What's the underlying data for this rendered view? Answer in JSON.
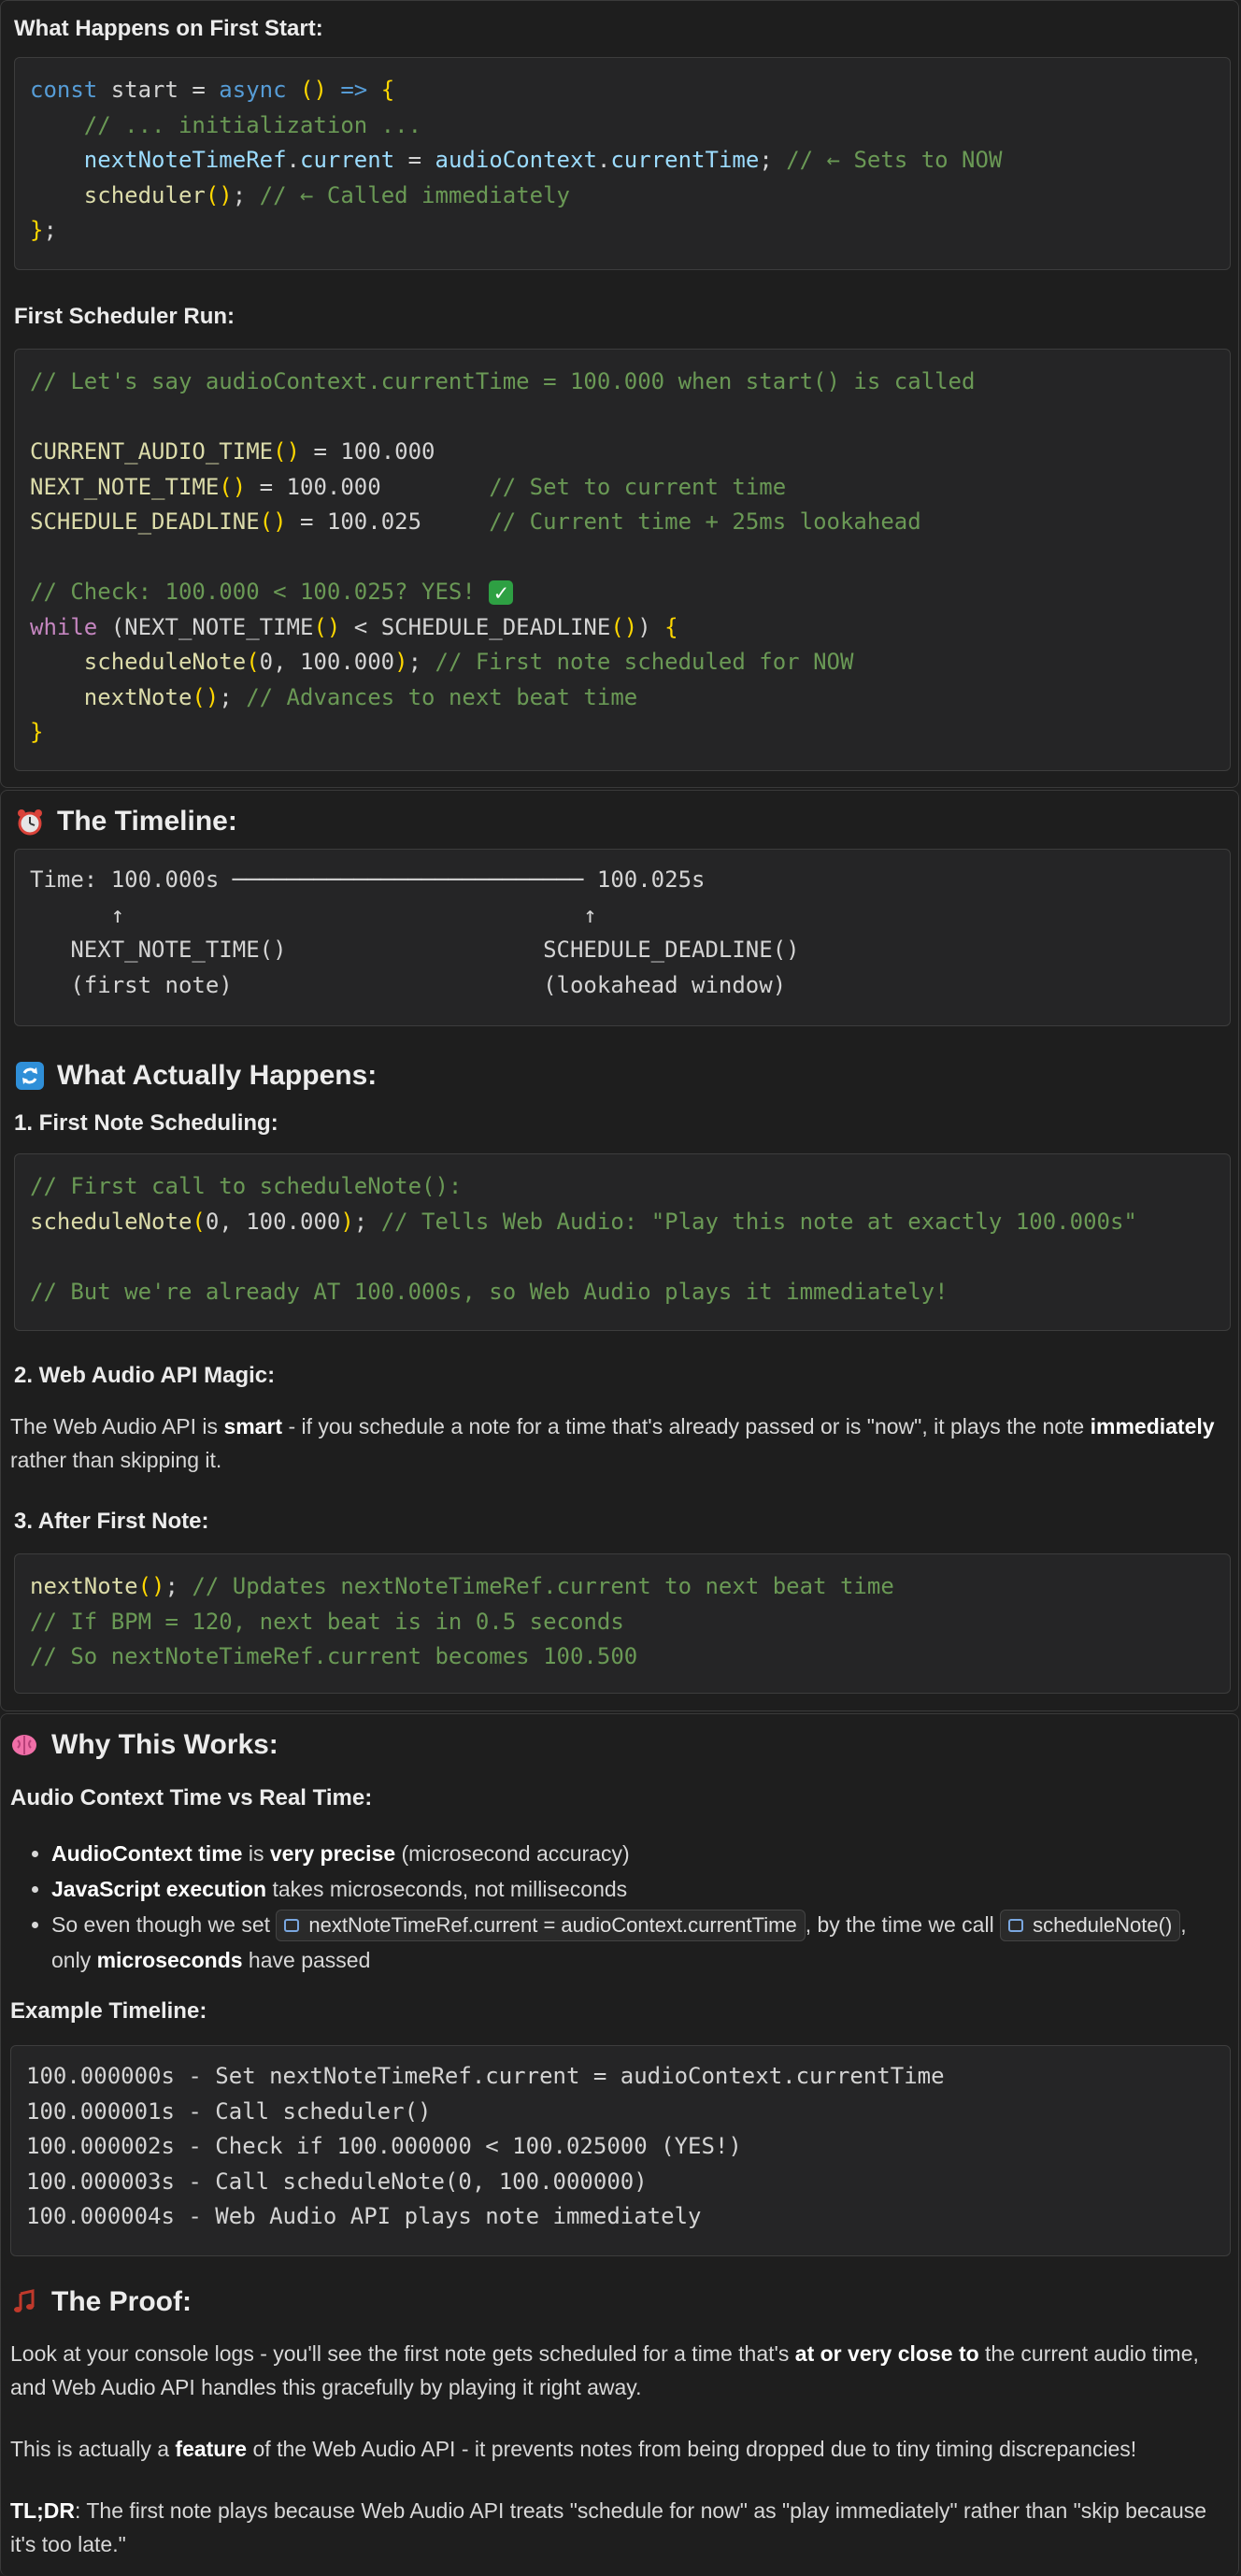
{
  "panel1": {
    "heading1": "What Happens on First Start:",
    "code1": [
      [
        [
          "k",
          "const"
        ],
        [
          "t",
          " start = "
        ],
        [
          "k",
          "async"
        ],
        [
          "t",
          " "
        ],
        [
          "p",
          "()"
        ],
        [
          "t",
          " "
        ],
        [
          "k",
          "=>"
        ],
        [
          "t",
          " "
        ],
        [
          "p",
          "{"
        ]
      ],
      [
        [
          "t",
          "    "
        ],
        [
          "c",
          "// ... initialization ..."
        ]
      ],
      [
        [
          "t",
          "    "
        ],
        [
          "v",
          "nextNoteTimeRef"
        ],
        [
          "t",
          "."
        ],
        [
          "v",
          "current"
        ],
        [
          "t",
          " = "
        ],
        [
          "v",
          "audioContext"
        ],
        [
          "t",
          "."
        ],
        [
          "v",
          "currentTime"
        ],
        [
          "t",
          "; "
        ],
        [
          "c",
          "// ← Sets to NOW"
        ]
      ],
      [
        [
          "t",
          "    "
        ],
        [
          "fn",
          "scheduler"
        ],
        [
          "p",
          "()"
        ],
        [
          "t",
          "; "
        ],
        [
          "c",
          "// ← Called immediately"
        ]
      ],
      [
        [
          "p",
          "}"
        ],
        [
          "t",
          ";"
        ]
      ]
    ],
    "heading2": "First Scheduler Run:",
    "code2": [
      [
        [
          "c",
          "// Let's say audioContext.currentTime = 100.000 when start() is called"
        ]
      ],
      [
        [
          "t",
          ""
        ]
      ],
      [
        [
          "fn",
          "CURRENT_AUDIO_TIME"
        ],
        [
          "p",
          "()"
        ],
        [
          "t",
          " = 100.000"
        ]
      ],
      [
        [
          "fn",
          "NEXT_NOTE_TIME"
        ],
        [
          "p",
          "()"
        ],
        [
          "t",
          " = 100.000        "
        ],
        [
          "c",
          "// Set to current time"
        ]
      ],
      [
        [
          "fn",
          "SCHEDULE_DEADLINE"
        ],
        [
          "p",
          "()"
        ],
        [
          "t",
          " = 100.025     "
        ],
        [
          "c",
          "// Current time + 25ms lookahead"
        ]
      ],
      [
        [
          "t",
          ""
        ]
      ],
      [
        [
          "c",
          "// Check: 100.000 < 100.025? YES! "
        ],
        [
          "chk",
          "✓"
        ]
      ],
      [
        [
          "kw",
          "while"
        ],
        [
          "t",
          " (NEXT_NOTE_TIME"
        ],
        [
          "p",
          "()"
        ],
        [
          "t",
          " < SCHEDULE_DEADLINE"
        ],
        [
          "p",
          "()"
        ],
        [
          "t",
          ") "
        ],
        [
          "p",
          "{"
        ]
      ],
      [
        [
          "t",
          "    "
        ],
        [
          "fn",
          "scheduleNote"
        ],
        [
          "p",
          "("
        ],
        [
          "t",
          "0, 100.000"
        ],
        [
          "p",
          ")"
        ],
        [
          "t",
          "; "
        ],
        [
          "c",
          "// First note scheduled for NOW"
        ]
      ],
      [
        [
          "t",
          "    "
        ],
        [
          "fn",
          "nextNote"
        ],
        [
          "p",
          "()"
        ],
        [
          "t",
          "; "
        ],
        [
          "c",
          "// Advances to next beat time"
        ]
      ],
      [
        [
          "p",
          "}"
        ]
      ]
    ]
  },
  "panel2": {
    "timeline_heading": "The Timeline:",
    "timeline": [
      "Time: 100.000s ────────────────────────── 100.025s",
      "      ↑                                  ↑",
      "   NEXT_NOTE_TIME()                   SCHEDULE_DEADLINE()",
      "   (first note)                       (lookahead window)"
    ],
    "actually_heading": "What Actually Happens:",
    "step1": "1. First Note Scheduling:",
    "code3": [
      [
        [
          "c",
          "// First call to scheduleNote():"
        ]
      ],
      [
        [
          "fn",
          "scheduleNote"
        ],
        [
          "p",
          "("
        ],
        [
          "t",
          "0, 100.000"
        ],
        [
          "p",
          ")"
        ],
        [
          "t",
          "; "
        ],
        [
          "c",
          "// Tells Web Audio: \"Play this note at exactly 100.000s\""
        ]
      ],
      [
        [
          "t",
          ""
        ]
      ],
      [
        [
          "c",
          "// But we're already AT 100.000s, so Web Audio plays it immediately!"
        ]
      ]
    ],
    "step2": "2. Web Audio API Magic:",
    "magic_parts": [
      [
        "t",
        "The Web Audio API is "
      ],
      [
        "b",
        "smart"
      ],
      [
        "t",
        " - if you schedule a note for a time that's already passed or is \"now\", it plays the note "
      ],
      [
        "b",
        "immediately"
      ],
      [
        "t",
        " rather than skipping it."
      ]
    ],
    "step3": "3. After First Note:",
    "code4": [
      [
        [
          "fn",
          "nextNote"
        ],
        [
          "p",
          "()"
        ],
        [
          "t",
          "; "
        ],
        [
          "c",
          "// Updates nextNoteTimeRef.current to next beat time"
        ]
      ],
      [
        [
          "c",
          "// If BPM = 120, next beat is in 0.5 seconds"
        ]
      ],
      [
        [
          "c",
          "// So nextNoteTimeRef.current becomes 100.500"
        ]
      ]
    ]
  },
  "panel3": {
    "why_heading": "Why This Works:",
    "sub1": "Audio Context Time vs Real Time:",
    "bullets": [
      [
        [
          "b",
          "AudioContext time"
        ],
        [
          "t",
          " is "
        ],
        [
          "b",
          "very precise"
        ],
        [
          "t",
          " (microsecond accuracy)"
        ]
      ],
      [
        [
          "b",
          "JavaScript execution"
        ],
        [
          "t",
          " takes microseconds, not milliseconds"
        ]
      ],
      [
        [
          "t",
          "So even though we set "
        ],
        [
          "chip",
          "nextNoteTimeRef.current = audioContext.currentTime"
        ],
        [
          "t",
          ", by the time we call "
        ],
        [
          "chip",
          "scheduleNote()"
        ],
        [
          "t",
          ", only "
        ],
        [
          "b",
          "microseconds"
        ],
        [
          "t",
          " have passed"
        ]
      ]
    ],
    "sub2": "Example Timeline:",
    "timeline2": [
      "100.000000s - Set nextNoteTimeRef.current = audioContext.currentTime",
      "100.000001s - Call scheduler()",
      "100.000002s - Check if 100.000000 < 100.025000 (YES!)",
      "100.000003s - Call scheduleNote(0, 100.000000)",
      "100.000004s - Web Audio API plays note immediately"
    ],
    "proof_heading": "The Proof:",
    "proof_parts": [
      [
        "t",
        "Look at your console logs - you'll see the first note gets scheduled for a time that's "
      ],
      [
        "b",
        "at or very close to"
      ],
      [
        "t",
        " the current audio time, and Web Audio API handles this gracefully by playing it right away."
      ]
    ],
    "feature_parts": [
      [
        "t",
        "This is actually a "
      ],
      [
        "b",
        "feature"
      ],
      [
        "t",
        " of the Web Audio API - it prevents notes from being dropped due to tiny timing discrepancies!"
      ]
    ],
    "tldr_parts": [
      [
        "b",
        "TL;DR"
      ],
      [
        "t",
        ": The first note plays because Web Audio API treats \"schedule for now\" as \"play immediately\" rather than \"skip because it's too late.\""
      ]
    ]
  },
  "icons": {
    "alarm": "alarm-clock-icon",
    "refresh": "refresh-icon",
    "brain": "brain-icon",
    "music": "music-note-icon",
    "check": "check-mark-icon"
  },
  "colors": {
    "background": "#1e1e1e",
    "code_background": "#252526",
    "keyword": "#569cd6",
    "comment": "#6a9955",
    "function": "#dcdcaa",
    "variable": "#9cdcfe",
    "bracket": "#ffd700",
    "control": "#c586c0"
  }
}
